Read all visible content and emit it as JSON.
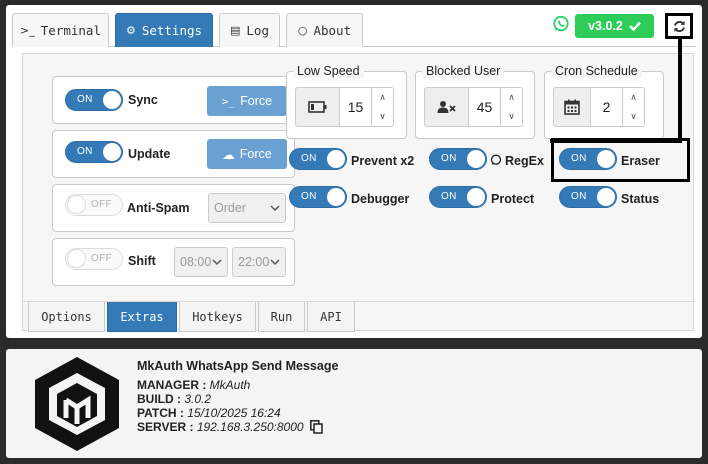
{
  "tabs": [
    {
      "label": "Terminal",
      "icon": "terminal-icon",
      "glyph": ">_"
    },
    {
      "label": "Settings",
      "icon": "gears-icon",
      "glyph": "⚙"
    },
    {
      "label": "Log",
      "icon": "list-icon",
      "glyph": "▤"
    },
    {
      "label": "About",
      "icon": "comment-icon",
      "glyph": "○"
    }
  ],
  "version": {
    "label": "v3.0.2",
    "icon": "check-icon",
    "color": "#2ecc59"
  },
  "refresh_icon": "refresh-icon",
  "whatsapp_icon": "whatsapp-icon",
  "rows": {
    "sync": {
      "toggle": "ON",
      "label": "Sync",
      "button": "Force",
      "button_icon": "terminal-icon",
      "button_glyph": ">_"
    },
    "update": {
      "toggle": "ON",
      "label": "Update",
      "button": "Force",
      "button_icon": "cloud-download-icon",
      "button_glyph": "☁"
    },
    "antispam": {
      "toggle": "OFF",
      "label": "Anti-Spam",
      "select": "Order"
    },
    "shift": {
      "toggle": "OFF",
      "label": "Shift",
      "start": "08:00",
      "end": "22:00"
    }
  },
  "fieldsets": {
    "low_speed": {
      "legend": "Low Speed",
      "value": "15",
      "icon": "battery-low-icon"
    },
    "blocked_user": {
      "legend": "Blocked User",
      "value": "45",
      "icon": "user-times-icon"
    },
    "cron": {
      "legend": "Cron Schedule",
      "value": "2",
      "icon": "calendar-icon"
    }
  },
  "switches": {
    "prevent": {
      "toggle": "ON",
      "label": "Prevent x2"
    },
    "regex": {
      "toggle": "ON",
      "label": "RegEx",
      "icon": "whatsapp-icon"
    },
    "eraser": {
      "toggle": "ON",
      "label": "Eraser"
    },
    "debugger": {
      "toggle": "ON",
      "label": "Debugger"
    },
    "protect": {
      "toggle": "ON",
      "label": "Protect"
    },
    "status": {
      "toggle": "ON",
      "label": "Status"
    }
  },
  "subtabs": [
    "Options",
    "Extras",
    "Hotkeys",
    "Run",
    "API"
  ],
  "footer": {
    "title": "MkAuth WhatsApp Send Message",
    "manager_label": "MANAGER :",
    "manager": "MkAuth",
    "build_label": "BUILD :",
    "build": "3.0.2",
    "patch_label": "PATCH :",
    "patch": "15/10/2025 16:24",
    "server_label": "SERVER :",
    "server": "192.168.3.250:8000",
    "copy_icon": "copy-icon",
    "logo_icon": "mkauth-logo-icon"
  },
  "colors": {
    "primary": "#337ab7",
    "button_light": "#6ba0d3",
    "success": "#2ecc59",
    "whatsapp": "#25d366"
  }
}
